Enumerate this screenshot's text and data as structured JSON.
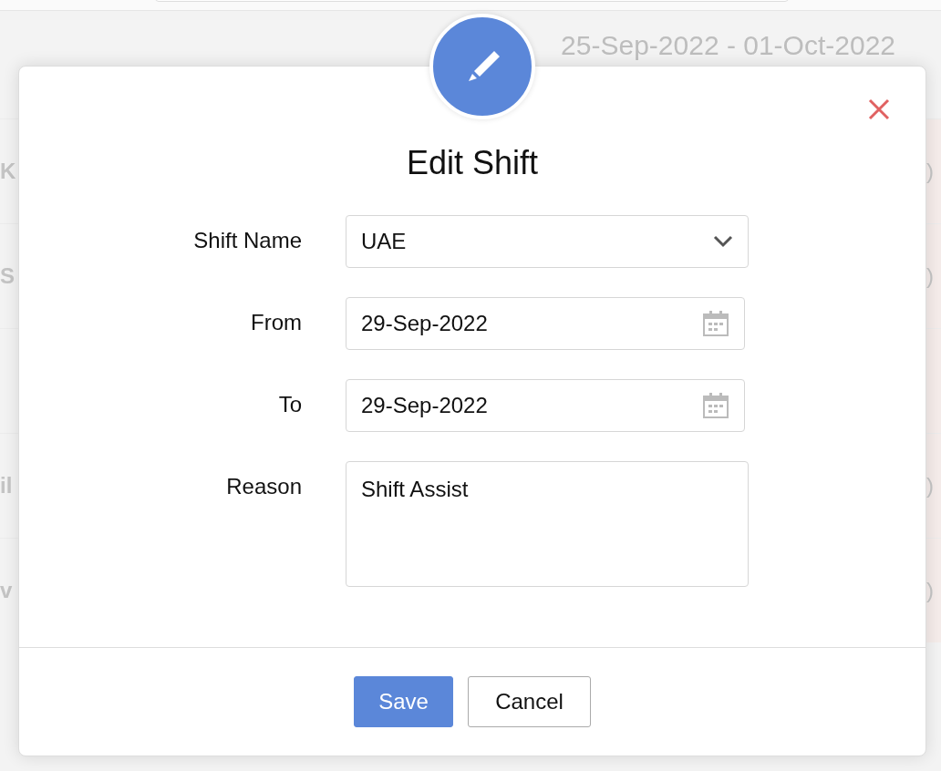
{
  "background": {
    "date_range": "25-Sep-2022 - 01-Oct-2022",
    "rows": [
      {
        "name": "K",
        "cell": ")"
      },
      {
        "name": "S",
        "cell": ")"
      },
      {
        "name": "",
        "cell": ""
      },
      {
        "name": "il",
        "cell": ")"
      },
      {
        "name": "v",
        "cell": ")"
      }
    ]
  },
  "dialog": {
    "title": "Edit Shift",
    "fields": [
      {
        "kind": "select",
        "label": "Shift Name",
        "value": "UAE"
      },
      {
        "kind": "date",
        "label": "From",
        "value": "29-Sep-2022"
      },
      {
        "kind": "date",
        "label": "To",
        "value": "29-Sep-2022"
      },
      {
        "kind": "textarea",
        "label": "Reason",
        "value": "Shift Assist"
      }
    ],
    "buttons": [
      {
        "kind": "primary",
        "label": "Save"
      },
      {
        "kind": "secondary",
        "label": "Cancel"
      }
    ]
  }
}
